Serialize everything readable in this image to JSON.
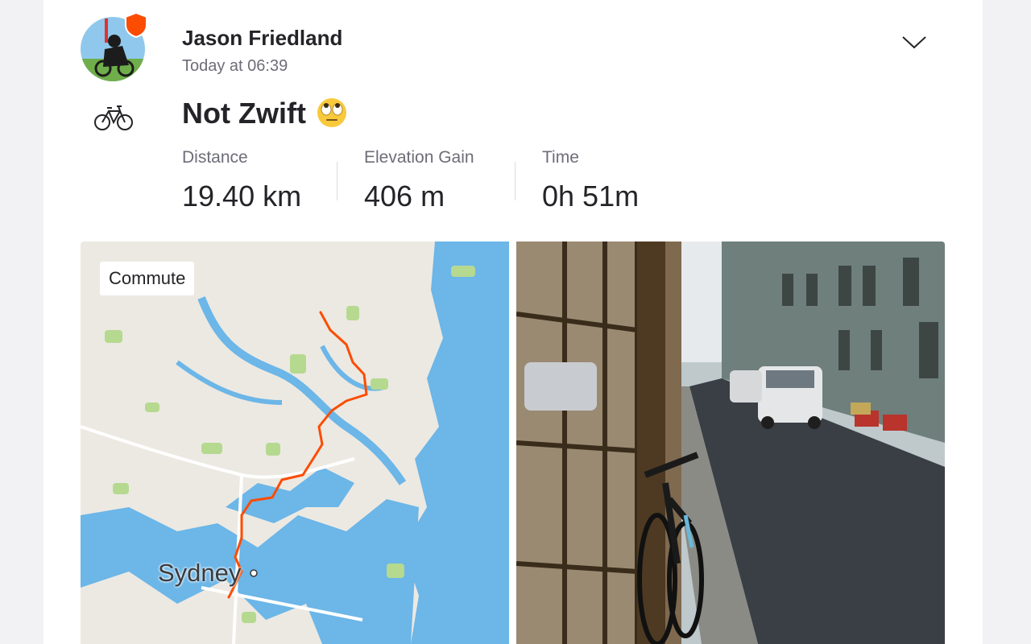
{
  "athlete": {
    "name": "Jason Friedland",
    "timestamp": "Today at 06:39"
  },
  "activity": {
    "title": "Not Zwift",
    "title_emoji": "face-with-rolling-eyes",
    "sport_icon": "bicycle-icon",
    "stats": [
      {
        "label": "Distance",
        "value": "19.40 km"
      },
      {
        "label": "Elevation Gain",
        "value": "406 m"
      },
      {
        "label": "Time",
        "value": "0h 51m"
      }
    ]
  },
  "map": {
    "tag": "Commute",
    "city_label": "Sydney",
    "route_color": "#fc4c02",
    "water_color": "#6cb6e8",
    "land_color": "#ece9e2"
  },
  "colors": {
    "brand": "#fc4c02",
    "text_primary": "#242428",
    "text_secondary": "#6d6d78"
  }
}
